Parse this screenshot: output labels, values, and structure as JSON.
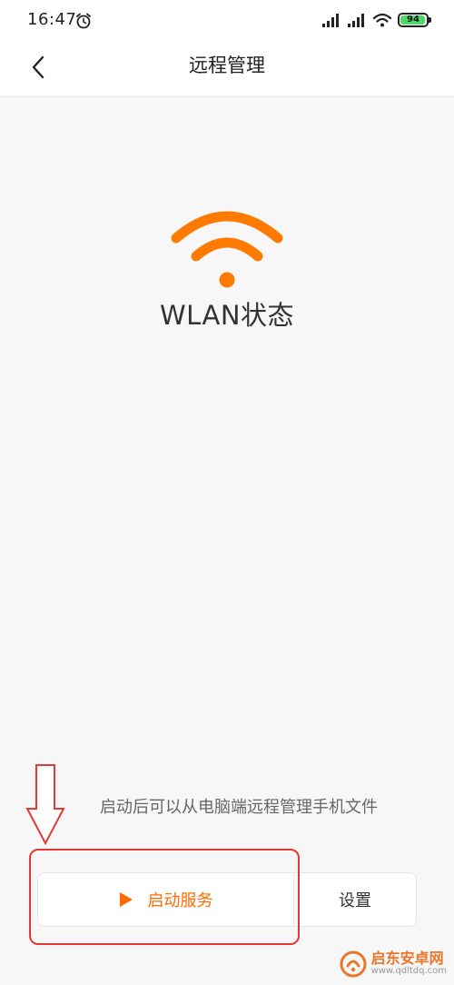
{
  "status_bar": {
    "time": "16:47",
    "battery_level": "94",
    "icons": [
      "alarm-icon",
      "signal-icon",
      "signal-icon",
      "wifi-icon",
      "battery-icon"
    ]
  },
  "header": {
    "title": "远程管理",
    "back_icon": "chevron-left-icon"
  },
  "main": {
    "status_icon": "wifi-icon",
    "status_label": "WLAN状态",
    "hint": "启动后可以从电脑端远程管理手机文件"
  },
  "actions": {
    "start_label": "启动服务",
    "start_icon": "play-icon",
    "settings_label": "设置"
  },
  "annotation": {
    "arrow_icon": "arrow-down-icon",
    "highlight_color": "#e53935"
  },
  "watermark": {
    "name": "启东安卓网",
    "url": "www.qdltdq.com"
  },
  "colors": {
    "accent": "#ff6a00",
    "wifi_icon": "#ff7a00",
    "battery": "#4cd964",
    "background": "#f7f7f7"
  }
}
